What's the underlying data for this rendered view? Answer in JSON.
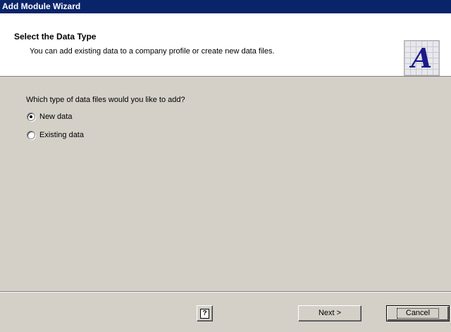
{
  "window": {
    "title": "Add Module Wizard"
  },
  "header": {
    "title": "Select the Data Type",
    "subtitle": "You can add existing data to a company profile or create new data files.",
    "logo_letter": "A"
  },
  "main": {
    "question": "Which type of data files would you like to add?",
    "options": [
      {
        "label": "New data",
        "selected": true
      },
      {
        "label": "Existing data",
        "selected": false
      }
    ]
  },
  "footer": {
    "help_icon": "?",
    "next_label": "Next >",
    "cancel_label": "Cancel"
  }
}
